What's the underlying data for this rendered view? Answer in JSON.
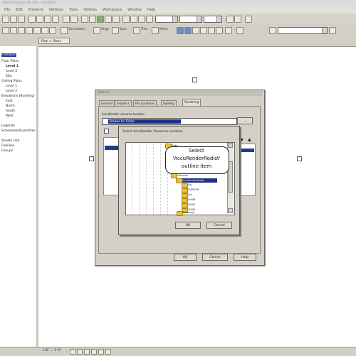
{
  "window": {
    "title": "MicroStation V8 XM - Untitled"
  },
  "menu": [
    "File",
    "Edit",
    "Element",
    "Settings",
    "Tools",
    "Utilities",
    "Workspace",
    "Window",
    "Help"
  ],
  "toolbar": {
    "simulation_label": "Simulation",
    "align_label": "Align",
    "spin_label": "Spin",
    "trim_label": "Trim",
    "move_label": "Move"
  },
  "view_tab": {
    "label": "Plan > Story"
  },
  "tree": {
    "items": [
      {
        "label": "Floorplan",
        "selected": true
      },
      {
        "label": "Floor Plans",
        "selected": false
      },
      {
        "label": "Level 1",
        "selected": false
      },
      {
        "label": "Level 2",
        "selected": false
      },
      {
        "label": "Site",
        "selected": false
      },
      {
        "label": "Ceiling Plans",
        "selected": false
      },
      {
        "label": "Level 1",
        "selected": false
      },
      {
        "label": "Level 2",
        "selected": false
      },
      {
        "label": "Elevations (Building)",
        "selected": false
      },
      {
        "label": "East",
        "selected": false
      },
      {
        "label": "North",
        "selected": false
      },
      {
        "label": "South",
        "selected": false
      },
      {
        "label": "West",
        "selected": false
      },
      {
        "label": "Legends",
        "selected": false
      },
      {
        "label": "Schedules/Quantities",
        "selected": false
      },
      {
        "label": "Sheets (all)",
        "selected": false
      },
      {
        "label": "Families",
        "selected": false
      },
      {
        "label": "Groups",
        "selected": false
      }
    ]
  },
  "dialog": {
    "title": "Options",
    "tabs": [
      "General",
      "Graphics",
      "File Locations",
      "Spelling",
      "Rendering"
    ],
    "active_tab": "Rendering",
    "location_label": "AccuRender resource location:",
    "location_value": "Browse for Folder",
    "ok_label": "OK",
    "cancel_label": "Cancel",
    "help_label": "Help"
  },
  "subdialog": {
    "header": "Select AccuRender Resource Location",
    "folders": [
      "Data",
      "Libraries",
      "AccuRender",
      "Lib",
      "SUPPORT",
      "Uni",
      "UI408",
      "UI400",
      "UI404",
      "Recovery"
    ],
    "selected_folder": "AccuRenderRedist",
    "ok_label": "OK",
    "cancel_label": "Cancel"
  },
  "callout": {
    "line1": "Select",
    "line2": "'AccuRenderRedist'",
    "line3": "outline item"
  },
  "status": {
    "scale": "1/8\" = 1'-0\""
  }
}
